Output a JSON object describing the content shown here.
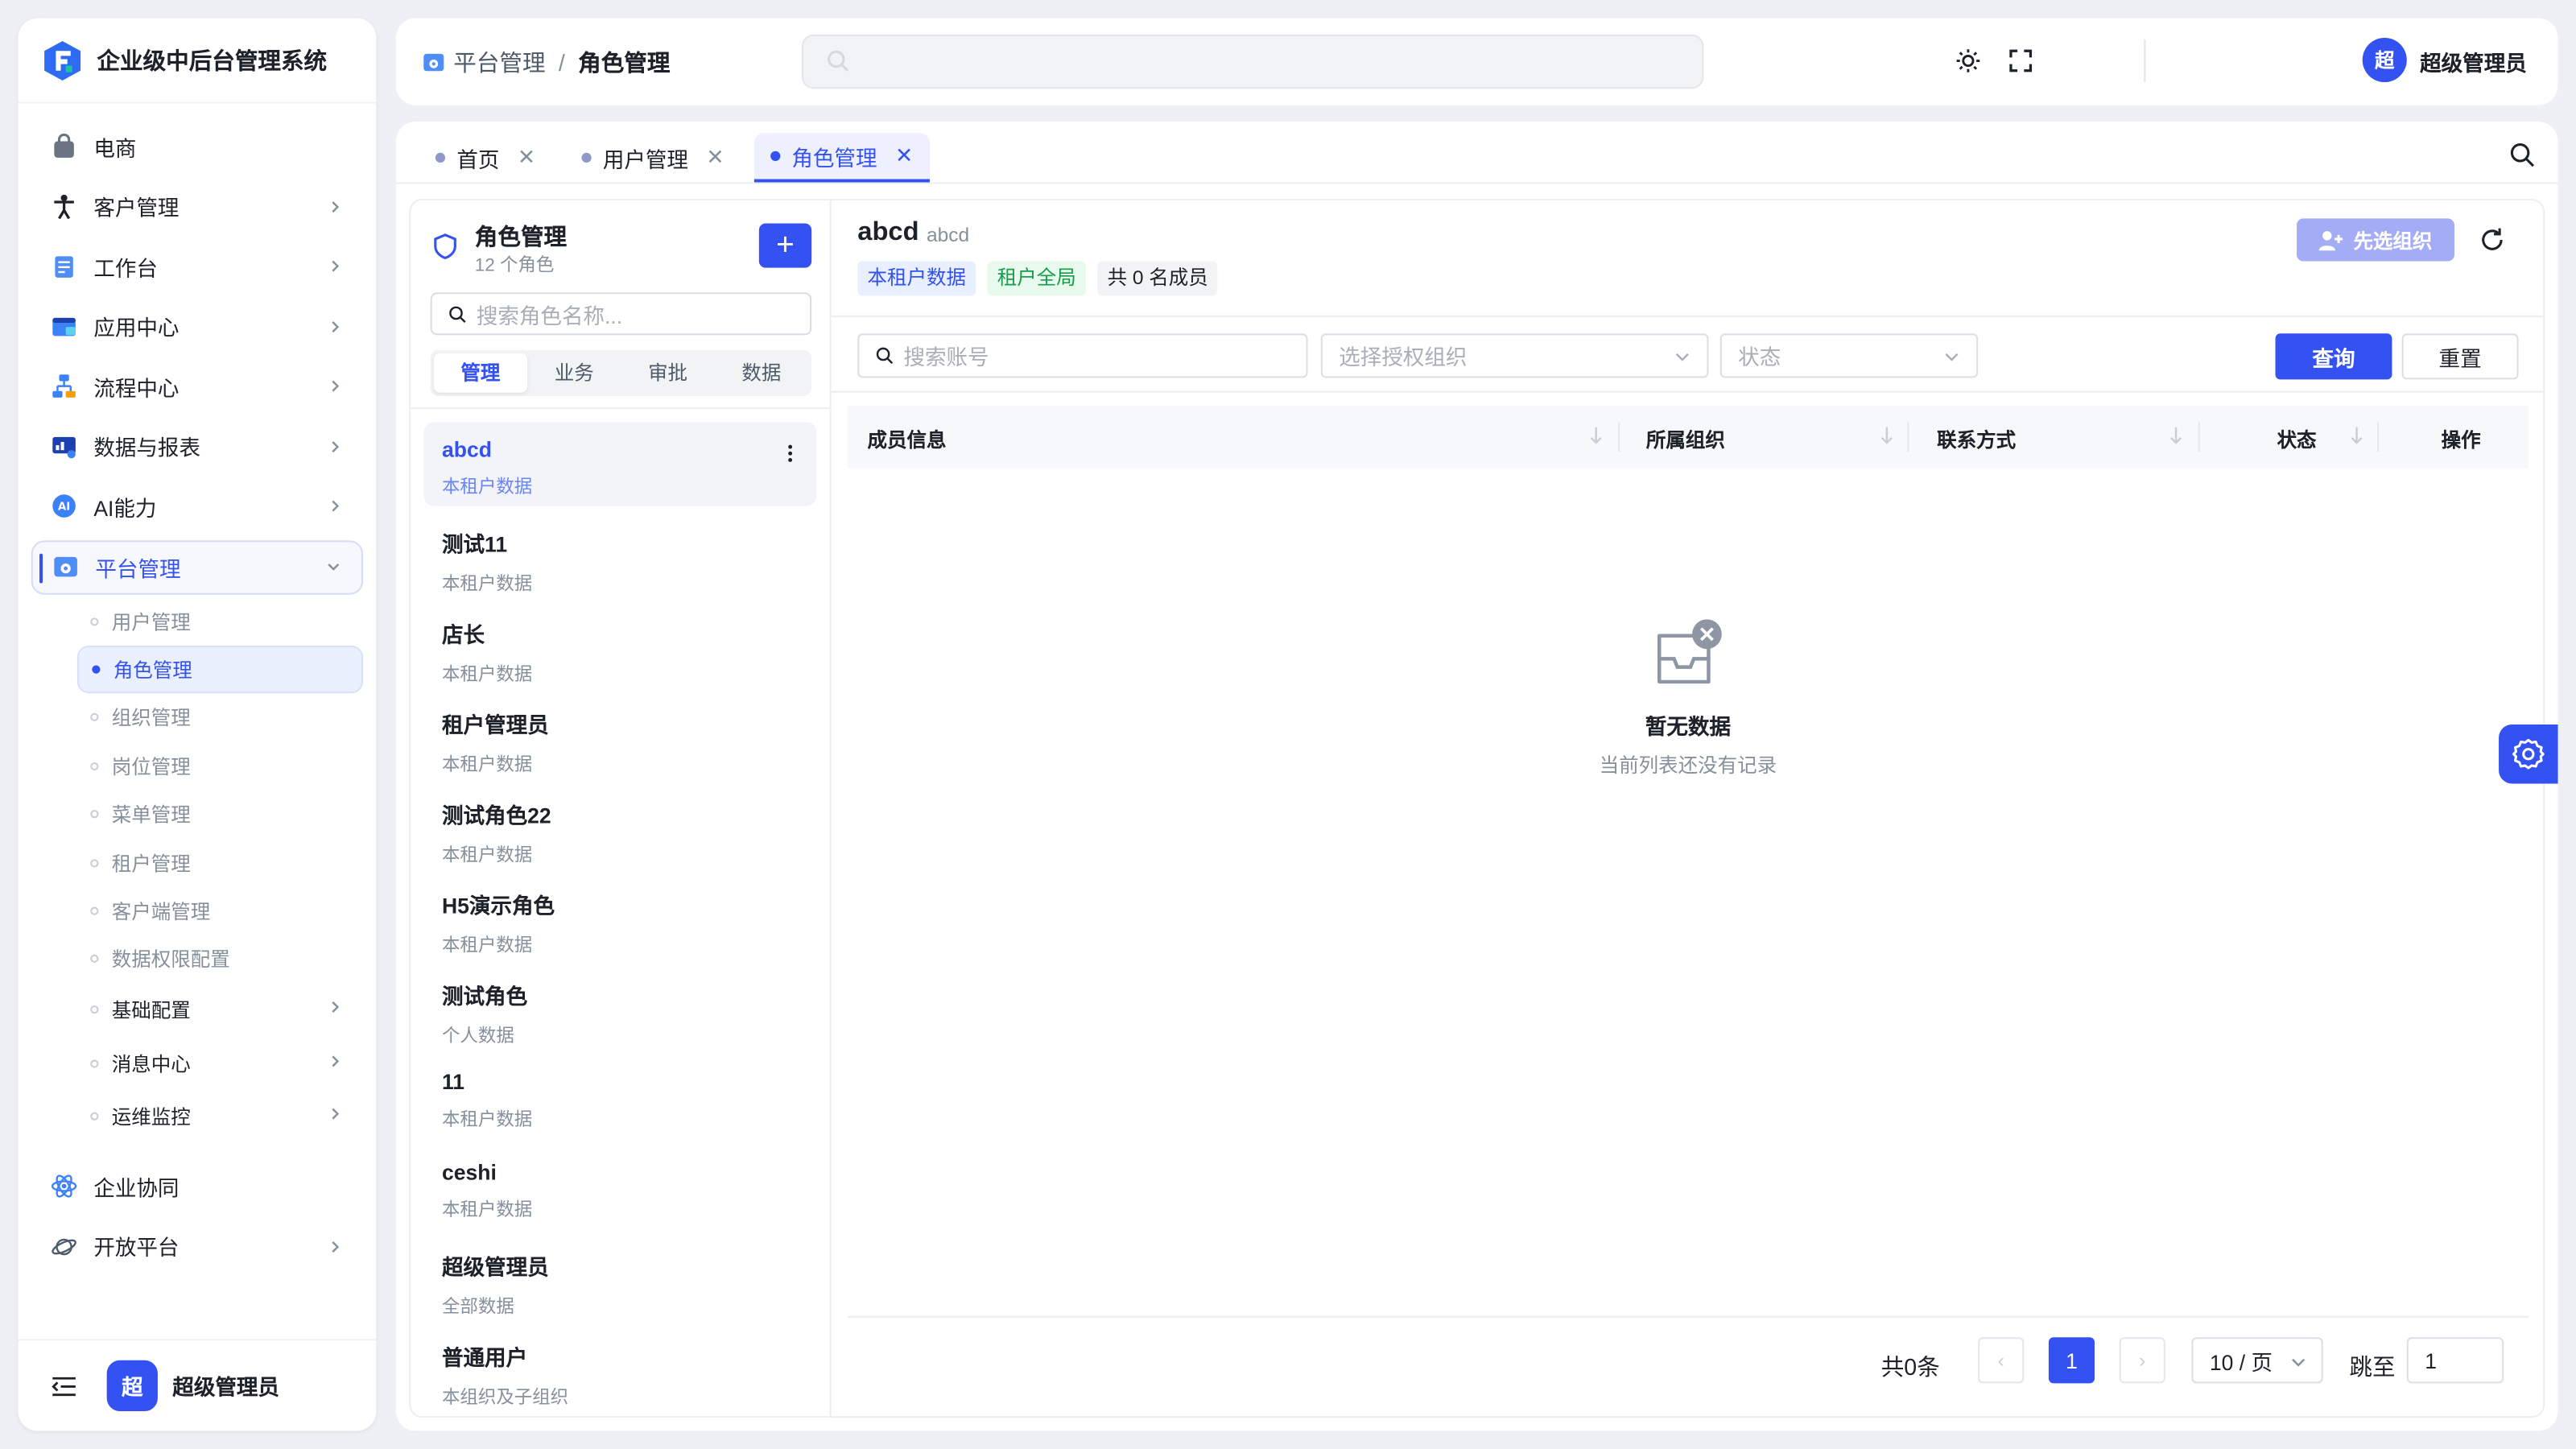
{
  "app": {
    "title": "企业级中后台管理系统"
  },
  "sidebar": {
    "items": [
      {
        "label": "电商",
        "icon": "shopping-bag-icon"
      },
      {
        "label": "客户管理",
        "icon": "person-icon"
      },
      {
        "label": "工作台",
        "icon": "clipboard-icon"
      },
      {
        "label": "应用中心",
        "icon": "app-window-icon"
      },
      {
        "label": "流程中心",
        "icon": "flowchart-icon"
      },
      {
        "label": "数据与报表",
        "icon": "chart-monitor-icon"
      },
      {
        "label": "AI能力",
        "icon": "ai-badge-icon"
      },
      {
        "label": "平台管理",
        "icon": "settings-panel-icon"
      }
    ],
    "sub_items": [
      "用户管理",
      "角色管理",
      "组织管理",
      "岗位管理",
      "菜单管理",
      "租户管理",
      "客户端管理",
      "数据权限配置"
    ],
    "sub_groups": [
      "基础配置",
      "消息中心",
      "运维监控"
    ],
    "bottom_items": [
      {
        "label": "企业协同",
        "icon": "atom-icon"
      },
      {
        "label": "开放平台",
        "icon": "planet-icon"
      }
    ],
    "footer": {
      "avatar": "超",
      "name": "超级管理员"
    }
  },
  "header": {
    "breadcrumb": [
      "平台管理",
      "角色管理"
    ],
    "search_placeholder": "",
    "avatar": "超",
    "user_name": "超级管理员"
  },
  "tabs": [
    {
      "label": "首页"
    },
    {
      "label": "用户管理"
    },
    {
      "label": "角色管理"
    }
  ],
  "role_panel": {
    "title": "角色管理",
    "count": "12 个角色",
    "add_label": "+",
    "search_placeholder": "搜索角色名称...",
    "segments": [
      "管理",
      "业务",
      "审批",
      "数据"
    ],
    "roles": [
      {
        "name": "abcd",
        "scope": "本租户数据"
      },
      {
        "name": "测试11",
        "scope": "本租户数据"
      },
      {
        "name": "店长",
        "scope": "本租户数据"
      },
      {
        "name": "租户管理员",
        "scope": "本租户数据"
      },
      {
        "name": "测试角色22",
        "scope": "本租户数据"
      },
      {
        "name": "H5演示角色",
        "scope": "本租户数据"
      },
      {
        "name": "测试角色",
        "scope": "个人数据"
      },
      {
        "name": "11",
        "scope": "本租户数据"
      },
      {
        "name": "ceshi",
        "scope": "本租户数据"
      },
      {
        "name": "超级管理员",
        "scope": "全部数据"
      },
      {
        "name": "普通用户",
        "scope": "本组织及子组织"
      }
    ]
  },
  "detail": {
    "name": "abcd",
    "code": "abcd",
    "tags": [
      "本租户数据",
      "租户全局",
      "共 0 名成员"
    ],
    "select_org_button": "先选组织",
    "filters": {
      "account_placeholder": "搜索账号",
      "org_placeholder": "选择授权组织",
      "status_placeholder": "状态",
      "query_button": "查询",
      "reset_button": "重置"
    },
    "columns": [
      "成员信息",
      "所属组织",
      "联系方式",
      "状态",
      "操作"
    ],
    "empty": {
      "title": "暂无数据",
      "subtitle": "当前列表还没有记录"
    },
    "pagination": {
      "total": "共0条",
      "current": "1",
      "page_size": "10 / 页",
      "jump_label": "跳至",
      "jump_value": "1"
    }
  },
  "colors": {
    "primary": "#3451f2",
    "primary_light": "#a3acf5",
    "success": "#1a9c4c"
  }
}
